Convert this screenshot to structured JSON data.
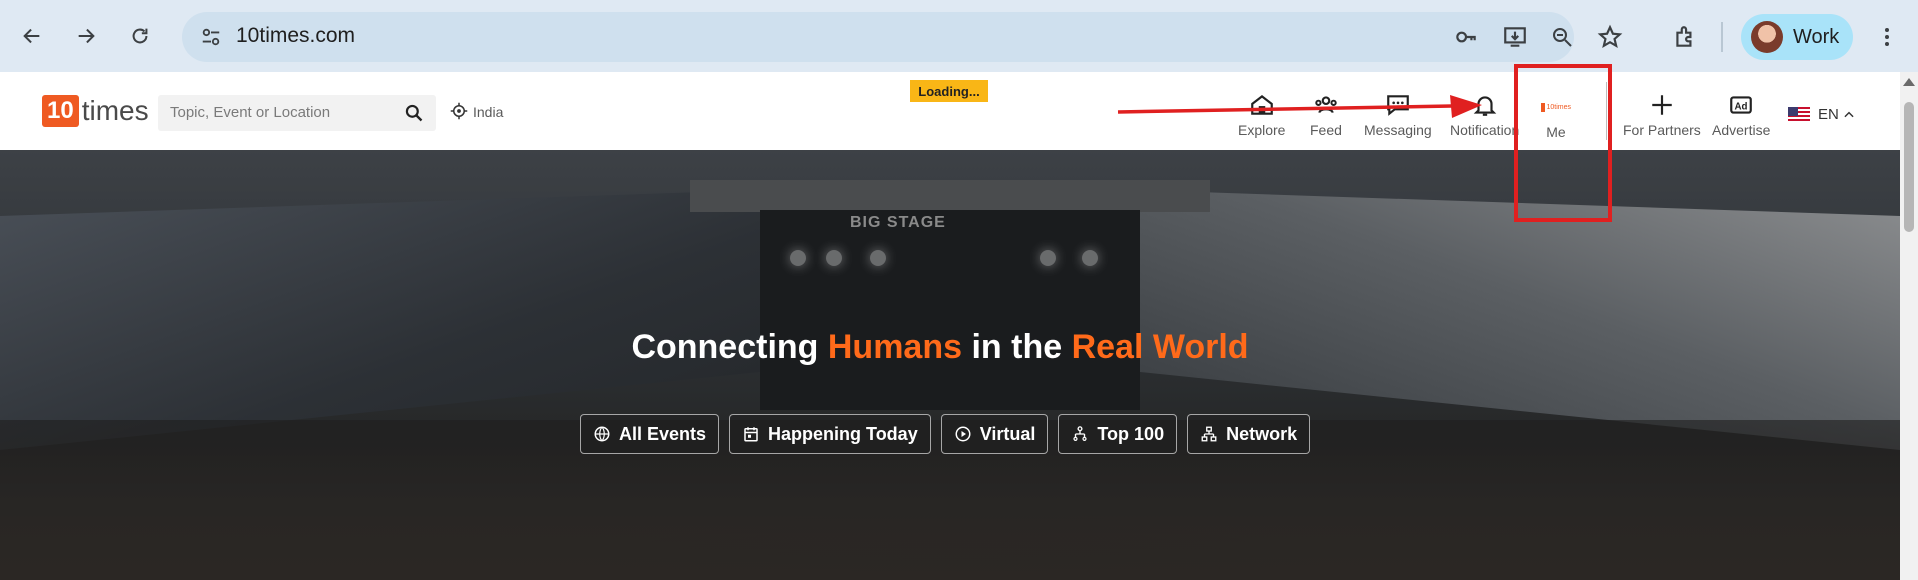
{
  "browser": {
    "url": "10times.com",
    "profile_label": "Work"
  },
  "header": {
    "logo_number": "10",
    "logo_word": "times",
    "search_placeholder": "Topic, Event or Location",
    "location": "India",
    "loading": "Loading...",
    "nav": {
      "explore": "Explore",
      "feed": "Feed",
      "messaging": "Messaging",
      "notification": "Notification",
      "me": "Me",
      "me_logo_text": "10times",
      "for_partners": "For Partners",
      "advertise": "Advertise",
      "advertise_badge": "Ad",
      "language": "EN"
    }
  },
  "hero": {
    "stage_text": "BIG STAGE",
    "title_part1": "Connecting ",
    "title_hl1": "Humans",
    "title_part2": " in the ",
    "title_hl2": "Real World",
    "chips": [
      "All Events",
      "Happening Today",
      "Virtual",
      "Top 100",
      "Network"
    ]
  },
  "colors": {
    "brand_orange": "#ef5a22",
    "annotation_red": "#e02020",
    "loading_yellow": "#f9b616"
  }
}
